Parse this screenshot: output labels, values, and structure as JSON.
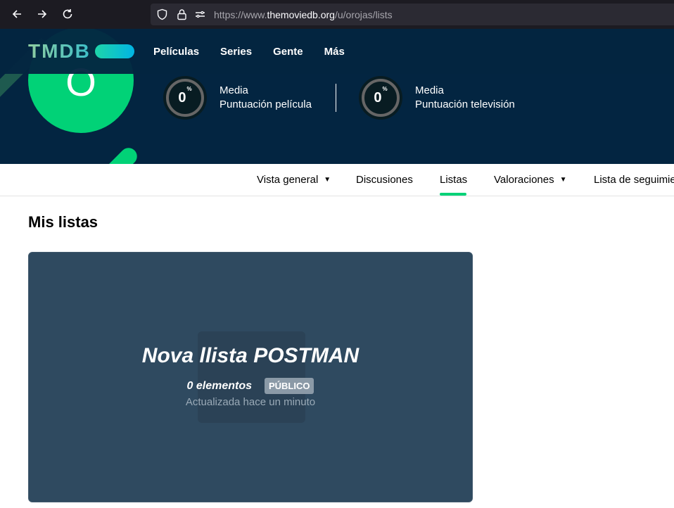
{
  "browser": {
    "url_prefix": "https://www.",
    "url_host": "themoviedb.org",
    "url_path": "/u/orojas/lists"
  },
  "header": {
    "logo": "TMDB",
    "menu": [
      "Películas",
      "Series",
      "Gente",
      "Más"
    ],
    "avatar_letter": "O",
    "scores": [
      {
        "value": "0",
        "unit": "%",
        "line1": "Media",
        "line2": "Puntuación película"
      },
      {
        "value": "0",
        "unit": "%",
        "line1": "Media",
        "line2": "Puntuación televisión"
      }
    ]
  },
  "subnav": {
    "items": [
      "Vista general",
      "Discusiones",
      "Listas",
      "Valoraciones",
      "Lista de seguimie"
    ],
    "active": "Listas"
  },
  "main": {
    "section_title": "Mis listas",
    "card": {
      "title": "Nova llista POSTMAN",
      "count": "0 elementos",
      "badge": "PÚBLICO",
      "updated": "Actualizada hace un minuto"
    }
  },
  "colors": {
    "header_bg": "#032541",
    "accent_green": "#01d277",
    "card_bg": "#2f4a60"
  }
}
